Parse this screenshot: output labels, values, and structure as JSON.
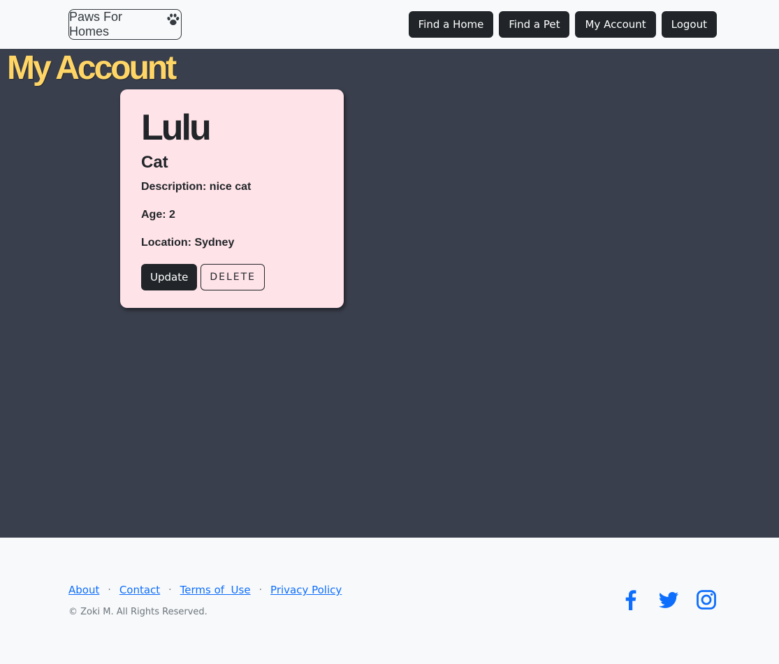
{
  "navbar": {
    "brand": "Paws For Homes",
    "brand_icon": "paw-icon",
    "links": [
      "Find a Home",
      "Find a Pet",
      "My Account",
      "Logout"
    ]
  },
  "main": {
    "title": "My Account",
    "pet": {
      "name": "Lulu",
      "type": "Cat",
      "description": "Description: nice cat",
      "age": "Age: 2",
      "location": "Location: Sydney",
      "update_label": "Update",
      "delete_label": "DELETE"
    }
  },
  "footer": {
    "links": [
      "About",
      "Contact",
      "Terms of  Use",
      "Privacy Policy"
    ],
    "separator": "·",
    "copyright": "© Zoki M. All Rights Reserved.",
    "socials": [
      "facebook-icon",
      "twitter-icon",
      "instagram-icon"
    ]
  },
  "colors": {
    "main_bg": "#3a3f4d",
    "title": "#ffd666",
    "card_bg": "#fee3e8",
    "button_dark": "#212529",
    "link": "#0d6efd"
  }
}
